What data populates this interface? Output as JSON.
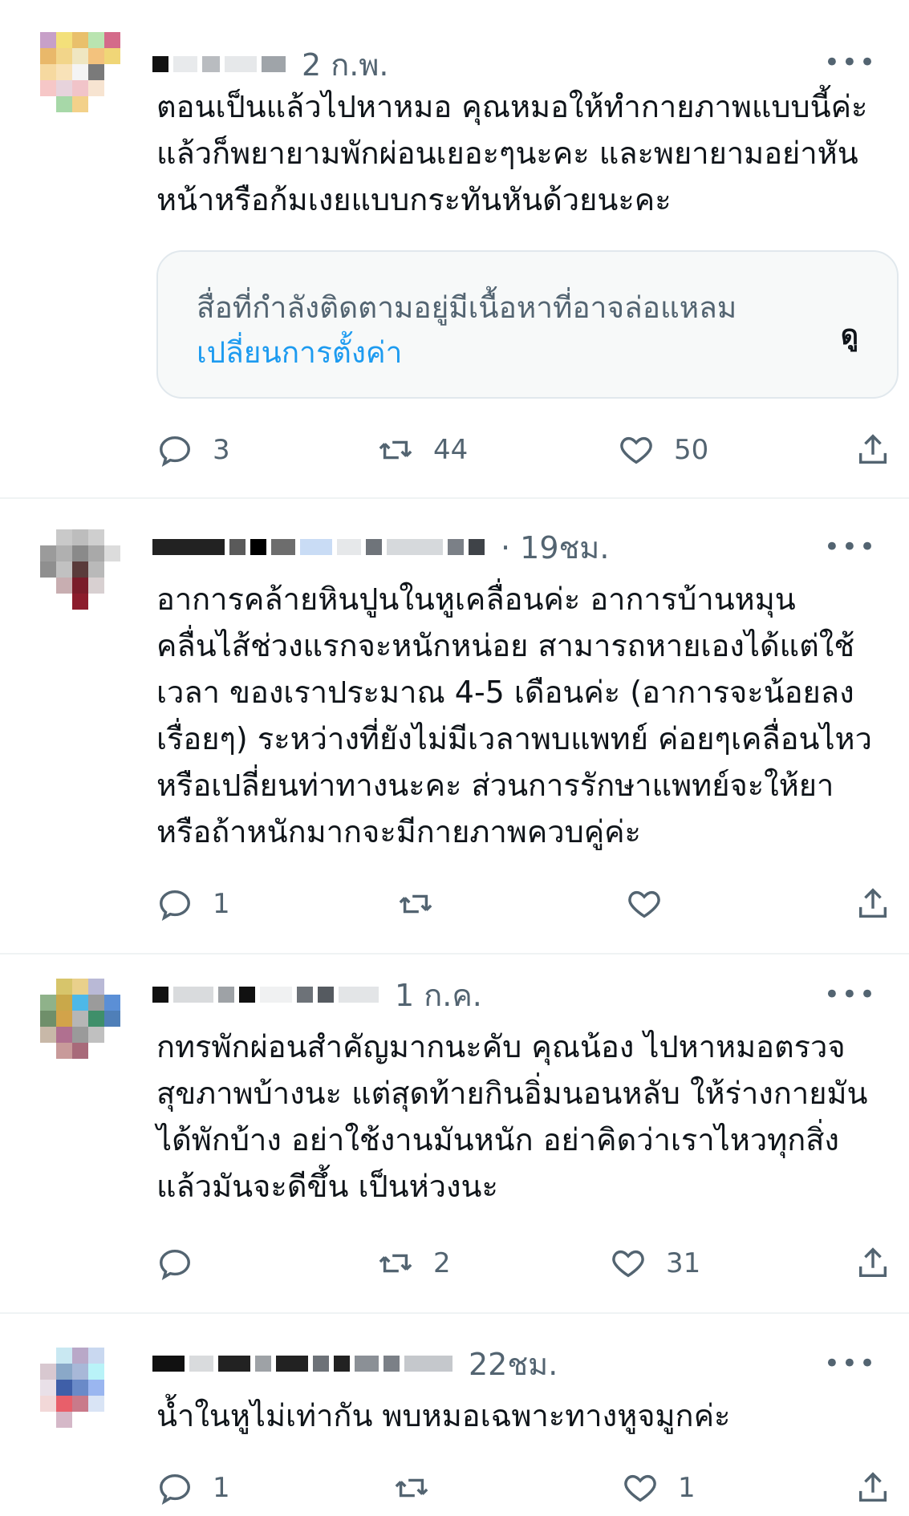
{
  "tweets": [
    {
      "time": "2 ก.พ.",
      "text": "ตอนเป็นแล้วไปหาหมอ คุณหมอให้ทำกายภาพแบบนี้ค่ะ แล้วก็พยายามพักผ่อนเยอะๆนะคะ และพยายามอย่าหันหน้าหรือก้มเงยแบบกระทันหันด้วยนะคะ",
      "sensitive": {
        "message": "สื่อที่กำลังติดตามอยู่มีเนื้อหาที่อาจล่อแหลม",
        "link": "เปลี่ยนการตั้งค่า",
        "view": "ดู"
      },
      "replies": "3",
      "retweets": "44",
      "likes": "50"
    },
    {
      "time": "· 19ชม.",
      "text": "อาการคล้ายหินปูนในหูเคลื่อนค่ะ อาการบ้านหมุน คลื่นไส้ช่วงแรกจะหนักหน่อย สามารถหายเองได้แต่ใช้เวลา ของเราประมาณ 4-5 เดือนค่ะ (อาการจะน้อยลงเรื่อยๆ) ระหว่างที่ยังไม่มีเวลาพบแพทย์ ค่อยๆเคลื่อนไหวหรือเปลี่ยนท่าทางนะคะ  ส่วนการรักษาแพทย์จะให้ยา หรือถ้าหนักมากจะมีกายภาพควบคู่ค่ะ",
      "replies": "1",
      "retweets": "",
      "likes": ""
    },
    {
      "time": "1 ก.ค.",
      "text": "กทรพักผ่อนสำคัญมากนะคับ คุณน้อง ไปหาหมอตรวจสุขภาพบ้างนะ แต่สุดท้ายกินอิ่มนอนหลับ ให้ร่างกายมันได้พักบ้าง อย่าใช้งานมันหนัก อย่าคิดว่าเราไหวทุกสิ่ง แล้วมันจะดีขึ้น เป็นห่วงนะ",
      "replies": "",
      "retweets": "2",
      "likes": "31"
    },
    {
      "time": "22ชม.",
      "text": "น้ำในหูไม่เท่ากัน พบหมอเฉพาะทางหูจมูกค่ะ",
      "replies": "1",
      "retweets": "",
      "likes": "1"
    }
  ],
  "more_label": "•••",
  "icons": [
    "reply-icon",
    "retweet-icon",
    "like-icon",
    "share-icon",
    "more-icon"
  ]
}
